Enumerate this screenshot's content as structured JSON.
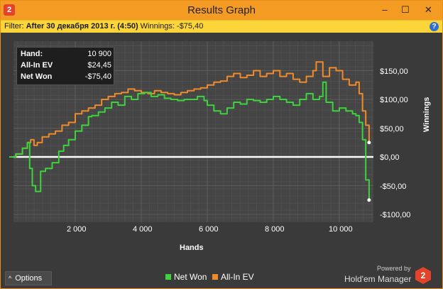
{
  "window": {
    "title": "Results Graph",
    "app_icon": "2",
    "controls": {
      "minimize": "–",
      "maximize": "☐",
      "close": "✕"
    }
  },
  "filter": {
    "label": "Filter:",
    "value": "After 30 декабря 2013 г. (4:50)",
    "winnings_label": "Winnings:",
    "winnings_value": "-$75,40",
    "help": "?"
  },
  "stats": {
    "hand_label": "Hand:",
    "hand_value": "10 900",
    "allin_label": "All-In EV",
    "allin_value": "$24,45",
    "netwon_label": "Net Won",
    "netwon_value": "-$75,40"
  },
  "legend": {
    "net_won": "Net Won",
    "allin_ev": "All-In EV"
  },
  "colors": {
    "net_won": "#3dd33d",
    "allin_ev": "#f08a2a",
    "zero_line": "#ffffff",
    "accent": "#f39b22"
  },
  "options_label": "Options",
  "branding": {
    "powered_by": "Powered by",
    "name": "Hold'em Manager",
    "logo": "2"
  },
  "chart_data": {
    "type": "line",
    "title": "",
    "xlabel": "Hands",
    "ylabel": "Winnings",
    "xlim": [
      0,
      11000
    ],
    "ylim": [
      -110,
      180
    ],
    "x_ticks": [
      2000,
      4000,
      6000,
      8000,
      10000
    ],
    "x_tick_labels": [
      "2 000",
      "4 000",
      "6 000",
      "8 000",
      "10 000"
    ],
    "y_ticks": [
      150,
      100,
      50,
      0,
      -50,
      -100
    ],
    "y_tick_labels": [
      "$150,00",
      "$100,00",
      "$50,00",
      "$0,00",
      "-$50,00",
      "-$100,00"
    ],
    "grid": true,
    "legend_position": "bottom-center",
    "series": [
      {
        "name": "Net Won",
        "x": [
          0,
          200,
          400,
          550,
          620,
          700,
          800,
          950,
          1100,
          1300,
          1500,
          1650,
          1800,
          2000,
          2200,
          2400,
          2500,
          2700,
          2900,
          3100,
          3300,
          3500,
          3700,
          3900,
          4100,
          4300,
          4500,
          4700,
          4900,
          5100,
          5300,
          5500,
          5700,
          5900,
          6000,
          6200,
          6400,
          6600,
          6800,
          7000,
          7200,
          7400,
          7600,
          7800,
          8000,
          8200,
          8400,
          8600,
          8800,
          9000,
          9200,
          9400,
          9500,
          9600,
          9800,
          10000,
          10200,
          10400,
          10500,
          10600,
          10700,
          10800,
          10900
        ],
        "y": [
          0,
          5,
          15,
          25,
          -20,
          -50,
          -60,
          -25,
          -20,
          -10,
          10,
          20,
          30,
          45,
          55,
          70,
          72,
          78,
          85,
          95,
          90,
          105,
          100,
          110,
          112,
          105,
          108,
          102,
          100,
          98,
          100,
          100,
          105,
          98,
          90,
          80,
          75,
          85,
          95,
          92,
          100,
          98,
          95,
          100,
          105,
          100,
          95,
          90,
          100,
          110,
          100,
          105,
          130,
          95,
          80,
          85,
          80,
          75,
          72,
          60,
          30,
          -40,
          -75
        ]
      },
      {
        "name": "All-In EV",
        "x": [
          0,
          200,
          400,
          550,
          650,
          750,
          850,
          1000,
          1200,
          1400,
          1600,
          1800,
          2000,
          2200,
          2400,
          2600,
          2800,
          3000,
          3200,
          3400,
          3600,
          3800,
          4000,
          4200,
          4400,
          4600,
          4800,
          5000,
          5200,
          5400,
          5600,
          5800,
          6000,
          6200,
          6400,
          6600,
          6800,
          7000,
          7200,
          7400,
          7600,
          7800,
          8000,
          8200,
          8400,
          8600,
          8800,
          9000,
          9200,
          9300,
          9500,
          9700,
          9900,
          10100,
          10300,
          10500,
          10600,
          10700,
          10800,
          10900
        ],
        "y": [
          0,
          5,
          15,
          25,
          30,
          20,
          25,
          35,
          40,
          45,
          55,
          60,
          75,
          80,
          85,
          90,
          100,
          105,
          110,
          112,
          118,
          115,
          112,
          110,
          115,
          112,
          110,
          108,
          112,
          115,
          118,
          120,
          125,
          130,
          132,
          140,
          145,
          138,
          142,
          150,
          140,
          145,
          150,
          140,
          145,
          135,
          130,
          140,
          150,
          165,
          140,
          155,
          150,
          135,
          125,
          130,
          110,
          80,
          55,
          25
        ]
      }
    ]
  }
}
